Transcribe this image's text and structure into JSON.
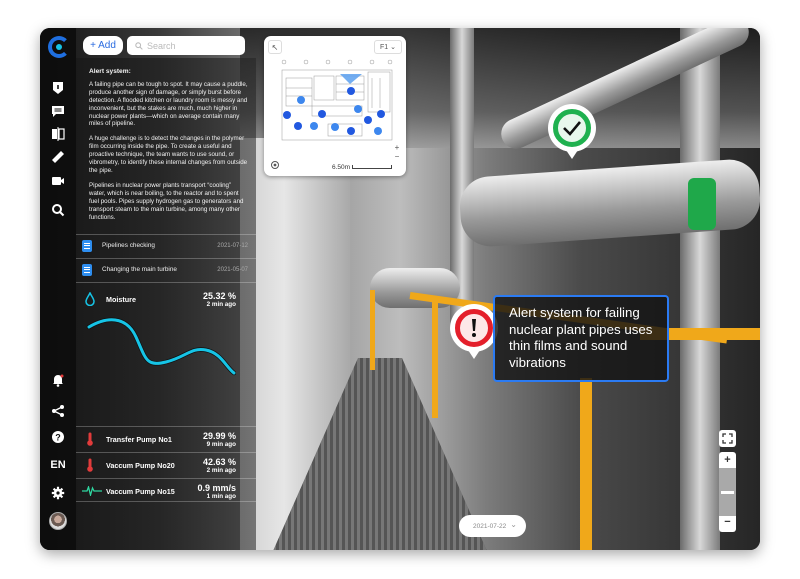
{
  "toolbar": {
    "add_label": "+ Add",
    "search_placeholder": "Search"
  },
  "sidebar": {
    "top_icons": [
      "alert-icon",
      "comment-icon",
      "compare-icon",
      "ruler-icon",
      "video-icon",
      "search-icon"
    ],
    "bottom_icons": [
      "bell-icon",
      "share-icon",
      "help-icon",
      "language",
      "gear-icon",
      "avatar"
    ],
    "language": "EN"
  },
  "article": {
    "title": "Alert system:",
    "paragraphs": [
      "A failing pipe can be tough to spot. It may cause a puddle, produce another sign of damage, or simply burst before detection. A flooded kitchen or laundry room is messy and inconvenient, but the stakes are much, much higher in nuclear power plants—which on average contain many miles of pipeline.",
      "A huge challenge is to detect the changes in the polymer film occurring inside the pipe. To create a useful and proactive technique, the team wants to use sound, or vibrometry, to identify these internal changes from outside the pipe.",
      "Pipelines in nuclear power plants transport “cooling” water, which is near boiling, to the reactor and to spent fuel pools. Pipes supply hydrogen gas to generators and transport steam to the main turbine, among many other functions."
    ]
  },
  "documents": [
    {
      "label": "Pipelines checking",
      "date": "2021-07-12",
      "icon": "document-icon"
    },
    {
      "label": "Changing the main turbine",
      "date": "2021-05-07",
      "icon": "document-icon"
    }
  ],
  "sensors": [
    {
      "name": "Moisture",
      "value": "25.32 %",
      "time": "2 min ago",
      "icon": "water-drop-icon",
      "color": "#16c4e6"
    },
    {
      "name": "Transfer Pump No1",
      "value": "29.99 %",
      "time": "9 min ago",
      "icon": "thermometer-icon",
      "color": "#e23b3b"
    },
    {
      "name": "Vaccum Pump No20",
      "value": "42.63 %",
      "time": "2 min ago",
      "icon": "thermometer-icon",
      "color": "#e23b3b"
    },
    {
      "name": "Vaccum Pump No15",
      "value": "0.9 mm/s",
      "time": "1 min ago",
      "icon": "vibration-icon",
      "color": "#2fd6a0"
    }
  ],
  "minimap": {
    "floor": "F1",
    "floor_chevron": "⌄",
    "scale_label": "6.50m",
    "plus": "+",
    "minus": "−"
  },
  "markers": {
    "callout_text": "Alert system for failing nuclear plant pipes uses thin films and sound vibrations",
    "ok_color": "#1fb14f",
    "warn_color": "#e41f2b"
  },
  "view_controls": {
    "zoom_in": "+",
    "zoom_out": "−",
    "zoom_level": 0.5
  },
  "timeline": {
    "date": "2021-07-22",
    "chevron": "⌄"
  },
  "colors": {
    "accent": "#2b7bf3",
    "logo_outer": "#1f6fe0",
    "logo_inner": "#16c4e6",
    "moisture_line": "#16c4e6"
  }
}
